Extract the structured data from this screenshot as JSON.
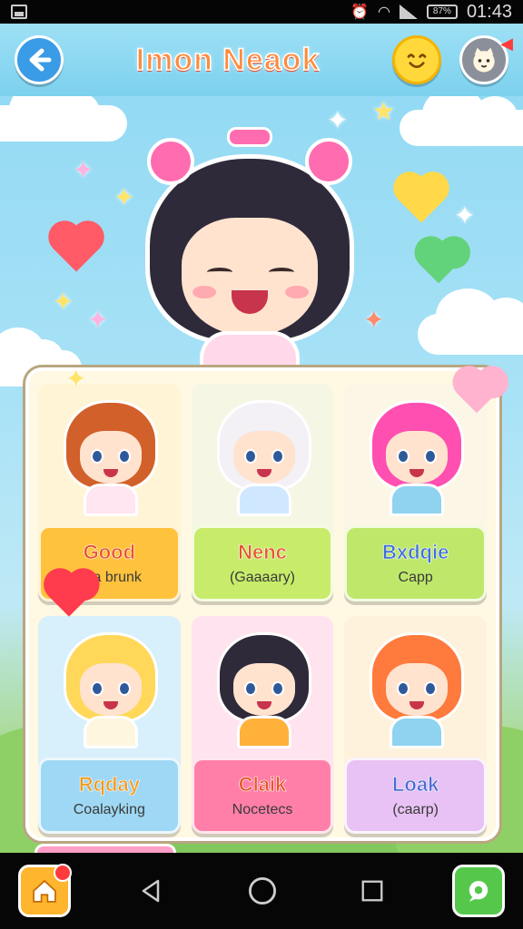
{
  "status_bar": {
    "time": "01:43",
    "battery": "87%"
  },
  "header": {
    "title": "Imon Neaok",
    "back_icon": "back-arrow-icon",
    "smile_icon": "smile-icon",
    "pet_icon": "pet-icon"
  },
  "cards": [
    {
      "title": "Good",
      "subtitle": "ana brunk",
      "title_color": "#e8542a",
      "bg": "#ffc23d",
      "card_bg": "#fff4d6",
      "hair": "#d2602a",
      "outfit": "#ffe6f1"
    },
    {
      "title": "Nenc",
      "subtitle": "(Gaaaary)",
      "title_color": "#e8542a",
      "bg": "#c8ec6a",
      "card_bg": "#f5f7e4",
      "hair": "#f3f0f6",
      "outfit": "#cfe8ff"
    },
    {
      "title": "Bxdqie",
      "subtitle": "Capp",
      "title_color": "#3f6fd8",
      "bg": "#bfe86b",
      "card_bg": "#fbf6e6",
      "hair": "#ff4fb0",
      "outfit": "#8fd3f0"
    },
    {
      "title": "Rqday",
      "subtitle": "Coalayking",
      "title_color": "#f09a1f",
      "bg": "#9fd8f4",
      "card_bg": "#d7f0fb",
      "hair": "#ffd85a",
      "outfit": "#fff6e0"
    },
    {
      "title": "Claik",
      "subtitle": "Nocetecs",
      "title_color": "#e8542a",
      "bg": "#ff7fa8",
      "card_bg": "#ffe3ee",
      "hair": "#2f2a3a",
      "outfit": "#ffb13a"
    },
    {
      "title": "Loak",
      "subtitle": "(caarp)",
      "title_color": "#4a6bd8",
      "bg": "#e8c2f4",
      "card_bg": "#fff2dc",
      "hair": "#ff7a3d",
      "outfit": "#8fd3f0"
    }
  ],
  "navbar": {
    "home_icon": "home-icon",
    "back_icon": "triangle-back-icon",
    "home_circle_icon": "circle-home-icon",
    "recents_icon": "square-recents-icon",
    "chat_icon": "chat-icon"
  }
}
